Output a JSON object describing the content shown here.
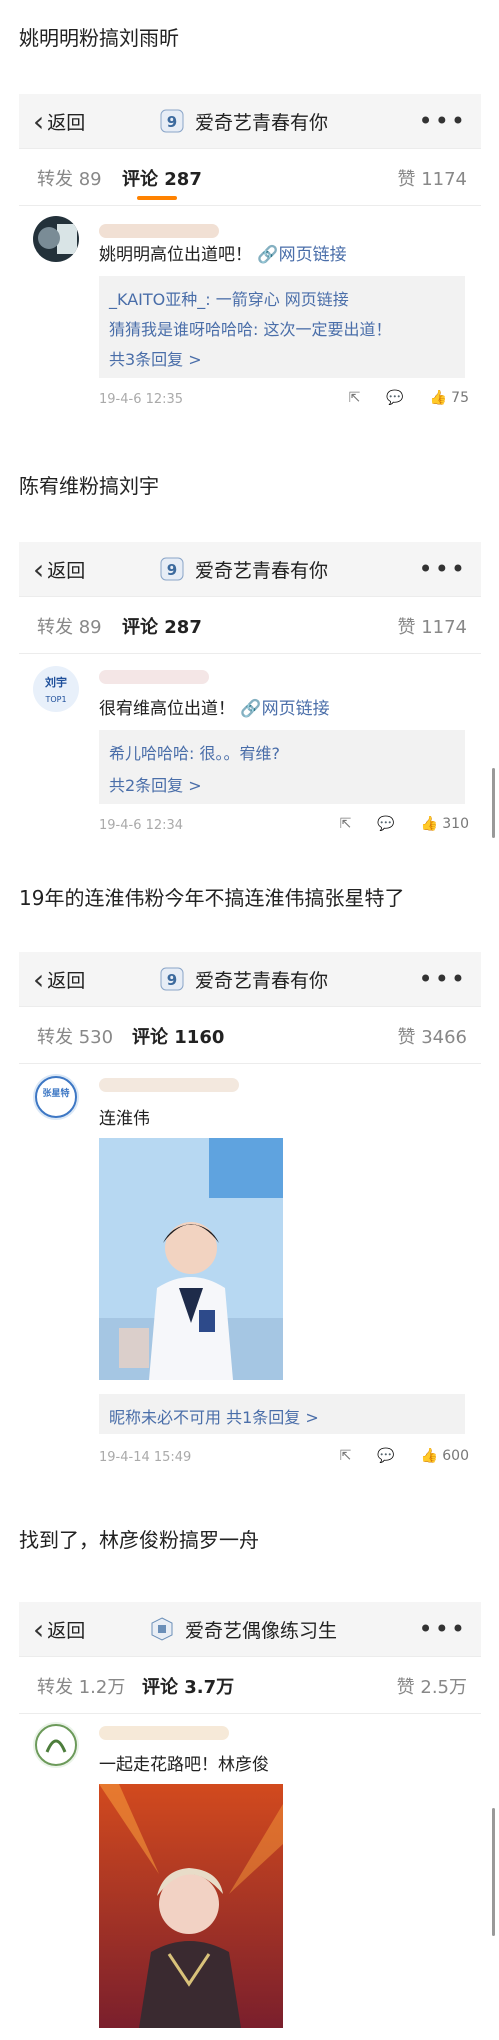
{
  "sections": [
    {
      "heading": "姚明明粉搞刘雨昕",
      "back_label": "返回",
      "nav_title": "爱奇艺青春有你",
      "more": "•••",
      "repost": "转发 89",
      "comments": "评论 287",
      "likes": "赞 1174",
      "comment_text": "姚明明高位出道吧！",
      "link_label": "网页链接",
      "replies": [
        "_KAITO亚种_: 一箭穿心 网页链接",
        "猜猜我是谁呀哈哈哈: 这次一定要出道！",
        "共3条回复 >"
      ],
      "time": "19-4-6 12:35",
      "like_count": "75"
    },
    {
      "heading": "陈宥维粉搞刘宇",
      "back_label": "返回",
      "nav_title": "爱奇艺青春有你",
      "more": "•••",
      "repost": "转发 89",
      "comments": "评论 287",
      "likes": "赞 1174",
      "comment_text": "很宥维高位出道！",
      "link_label": "网页链接",
      "replies": [
        "希儿哈哈哈: 很。。宥维?",
        "共2条回复 >"
      ],
      "time": "19-4-6 12:34",
      "like_count": "310",
      "avatar_text": "刘宇",
      "avatar_sub": "TOP1"
    },
    {
      "heading": "19年的连淮伟粉今年不搞连淮伟搞张星特了",
      "back_label": "返回",
      "nav_title": "爱奇艺青春有你",
      "more": "•••",
      "repost": "转发 530",
      "comments": "评论 1160",
      "likes": "赞 3466",
      "comment_text": "连淮伟",
      "replies": [
        "昵称未必不可用 共1条回复 >"
      ],
      "time": "19-4-14 15:49",
      "like_count": "600",
      "avatar_text": "张星特"
    },
    {
      "heading": "找到了，林彦俊粉搞罗一舟",
      "back_label": "返回",
      "nav_title": "爱奇艺偶像练习生",
      "more": "•••",
      "repost": "转发 1.2万",
      "comments": "评论 3.7万",
      "likes": "赞 2.5万",
      "comment_text": "一起走花路吧！林彦俊"
    }
  ],
  "colors": {
    "accent": "#ff8200",
    "link": "#4a6ea9",
    "nav_bg": "#f5f5f5",
    "reply_bg": "#f2f2f2"
  }
}
